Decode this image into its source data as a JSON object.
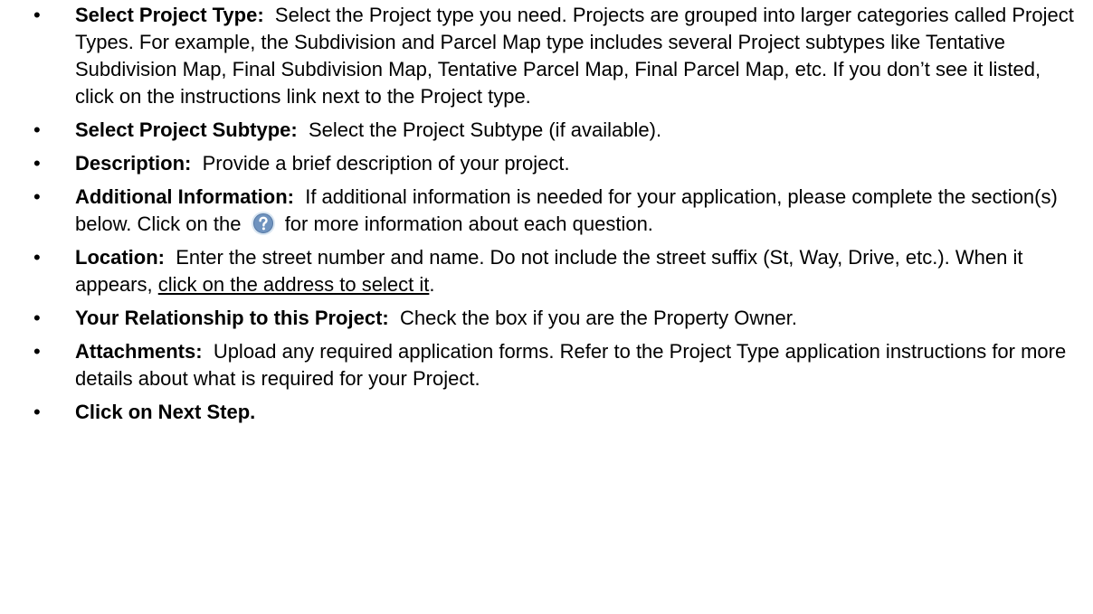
{
  "items": [
    {
      "term": "Select Project Type:",
      "text": "Select the Project type you need.  Projects are grouped into larger categories called Project Types.  For example, the Subdivision and Parcel Map type includes several Project subtypes like Tentative Subdivision Map, Final Subdivision Map, Tentative Parcel Map, Final Parcel Map, etc.  If you don’t see it listed, click on the instructions link next to the Project type."
    },
    {
      "term": "Select Project Subtype:",
      "text": "Select the Project Subtype (if available)."
    },
    {
      "term": "Description:",
      "text": "Provide a brief description of your project."
    },
    {
      "term": "Additional Information:",
      "text_before": "If additional information is needed for your application, please complete the section(s) below.  Click on the",
      "icon": "help-question-icon",
      "text_after": "for more information about each question."
    },
    {
      "term": "Location:",
      "text_before": "Enter the street number and name.  Do not include the street suffix (St, Way, Drive, etc.).  When it appears,",
      "link_text": "click on the address to select it",
      "text_after": "."
    },
    {
      "term": "Your Relationship to this Project:",
      "text": "Check the box if you are the Property Owner."
    },
    {
      "term": "Attachments:",
      "text": "Upload any required application forms. Refer to the Project Type application instructions for more details about what is required for your Project."
    },
    {
      "term": "Click on Next Step."
    }
  ],
  "bullet_char": "•",
  "colors": {
    "text": "#000000",
    "help_icon_fill": "#6f93bf",
    "help_icon_ring": "#d9e6f2"
  }
}
